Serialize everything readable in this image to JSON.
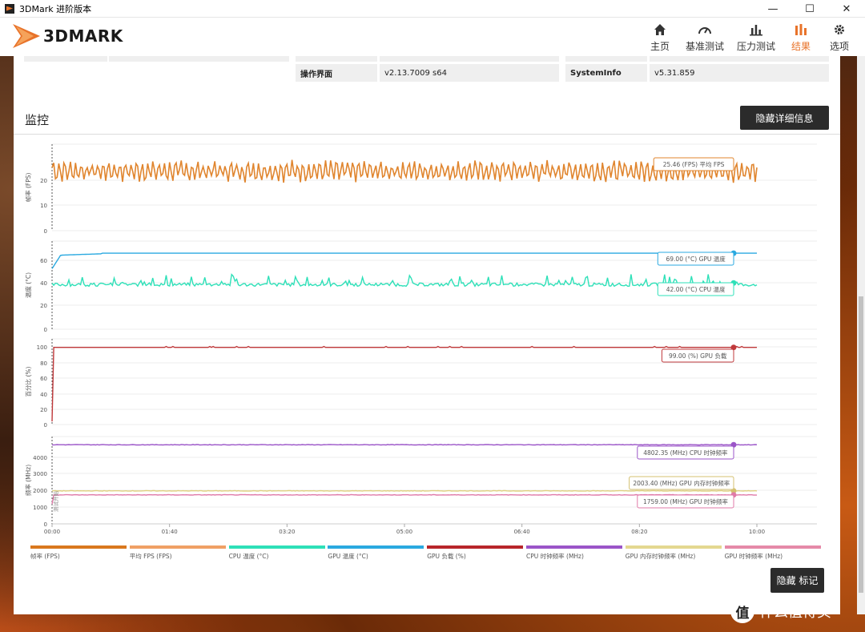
{
  "window": {
    "title": "3DMark 进阶版本",
    "minimize": "—",
    "maximize": "☐",
    "close": "✕"
  },
  "app": {
    "logo_text": "3DMARK"
  },
  "nav": [
    {
      "label": "主页",
      "icon": "home-icon"
    },
    {
      "label": "基准测试",
      "icon": "gauge-icon"
    },
    {
      "label": "压力测试",
      "icon": "bar-chart-icon"
    },
    {
      "label": "结果",
      "icon": "results-icon",
      "active": true
    },
    {
      "label": "选项",
      "icon": "gear-icon"
    }
  ],
  "info": {
    "row_label": "操作界面",
    "row_value": "v2.13.7009 s64",
    "row2_label": "SystemInfo",
    "row2_value": "v5.31.859"
  },
  "monitor": {
    "title": "监控",
    "hide_details": "隐藏详细信息",
    "hide_markers": "隐藏 标记"
  },
  "chart_data": {
    "type": "line",
    "x_ticks": [
      "00:00",
      "01:40",
      "03:20",
      "05:00",
      "06:40",
      "08:20",
      "10:00"
    ],
    "panels": [
      {
        "ylabel": "帧率 (FPS)",
        "yticks": [
          "20",
          "10",
          "0"
        ],
        "ylim": [
          0,
          37
        ],
        "series": [
          {
            "name": "帧率 (FPS)",
            "color": "#e0852e",
            "approx_mean": 25.5
          }
        ],
        "markers": [
          {
            "text": "25.46 (FPS) 平均 FPS",
            "color": "#e0852e"
          }
        ]
      },
      {
        "ylabel": "温度 (°C)",
        "yticks": [
          "60",
          "40",
          "20",
          "0"
        ],
        "ylim": [
          0,
          80
        ],
        "series": [
          {
            "name": "GPU 温度 (°C)",
            "color": "#2aa9e0",
            "value": 69.0
          },
          {
            "name": "CPU 温度 (°C)",
            "color": "#2ee0b8",
            "approx_mean": 42.0
          }
        ],
        "markers": [
          {
            "text": "69.00 (°C) GPU 温度",
            "color": "#2aa9e0"
          },
          {
            "text": "42.00 (°C) CPU 温度",
            "color": "#2ee0b8"
          }
        ]
      },
      {
        "ylabel": "百分比 (%)",
        "yticks": [
          "100",
          "80",
          "60",
          "40",
          "20",
          "0"
        ],
        "ylim": [
          0,
          110
        ],
        "series": [
          {
            "name": "GPU 负载 (%)",
            "color": "#c0393b",
            "value": 99.0
          }
        ],
        "markers": [
          {
            "text": "99.00 (%) GPU 负载",
            "color": "#c0393b"
          }
        ]
      },
      {
        "ylabel": "频率 (MHz)",
        "yticks": [
          "4000",
          "3000",
          "2000",
          "1000",
          "0"
        ],
        "ylim": [
          0,
          5300
        ],
        "series": [
          {
            "name": "CPU 时钟频率 (MHz)",
            "color": "#9b55c8",
            "value": 4802.35
          },
          {
            "name": "GPU 内存时钟频率 (MHz)",
            "color": "#e0d080",
            "value": 2003.4
          },
          {
            "name": "GPU 时钟频率 (MHz)",
            "color": "#e07aa8",
            "value": 1759.0
          }
        ],
        "markers": [
          {
            "text": "4802.35 (MHz) CPU 时钟频率",
            "color": "#9b55c8"
          },
          {
            "text": "2003.40 (MHz) GPU 内存时钟频率",
            "color": "#d4c070"
          },
          {
            "text": "1759.00 (MHz) GPU 时钟频率",
            "color": "#e07aa8"
          }
        ],
        "annotation": "测试开始"
      }
    ],
    "legend": [
      {
        "name": "帧率 (FPS)",
        "color": "#d9781e"
      },
      {
        "name": "平均 FPS (FPS)",
        "color": "#f0a065"
      },
      {
        "name": "CPU 温度 (°C)",
        "color": "#2ee0b8"
      },
      {
        "name": "GPU 温度 (°C)",
        "color": "#2aa9e0"
      },
      {
        "name": "GPU 负载 (%)",
        "color": "#b8262a"
      },
      {
        "name": "CPU 时钟频率 (MHz)",
        "color": "#9b55c8"
      },
      {
        "name": "GPU 内存时钟频率 (MHz)",
        "color": "#e4d890"
      },
      {
        "name": "GPU 时钟频率 (MHz)",
        "color": "#e58aa8"
      }
    ]
  },
  "watermark": {
    "badge": "值",
    "text": "什么值得买"
  }
}
